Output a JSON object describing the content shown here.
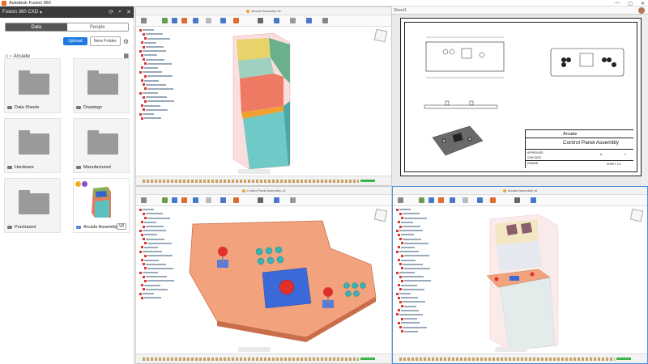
{
  "titlebar": {
    "title": "Autodesk Fusion 360",
    "min": "—",
    "max": "▢",
    "close": "✕"
  },
  "data_panel": {
    "team": "Fusion 360 CXD",
    "tabs": [
      {
        "label": "Data"
      },
      {
        "label": "People"
      }
    ],
    "upload_label": "Upload",
    "new_folder_label": "New Folder",
    "breadcrumb": "Arcade",
    "items": [
      {
        "name": "Data Sheets",
        "kind": "folder"
      },
      {
        "name": "Drawings",
        "kind": "folder"
      },
      {
        "name": "Hardware",
        "kind": "folder"
      },
      {
        "name": "Manufactured",
        "kind": "folder"
      },
      {
        "name": "Purchased",
        "kind": "folder"
      },
      {
        "name": "Arcade Assembly",
        "kind": "design",
        "version": "V8"
      }
    ]
  },
  "drawing": {
    "sheet_label": "Sheet1",
    "company": "Arcade",
    "title": "Control Panel Assembly",
    "approved_label": "APPROVED",
    "checked_label": "CHECKED",
    "drawn_label": "DRAWN",
    "size": "A",
    "rev": "1",
    "sheet": "SHEET 1/1"
  },
  "viewport_titles": [
    "Arcade Assembly v8",
    "Control Panel Assembly v3",
    "Arcade Assembly v8"
  ],
  "colors": {
    "accent": "#1f7ae0",
    "panel_dark": "#3b3b3b",
    "model_orange": "#f4a07a",
    "model_blue": "#5a7bd6",
    "model_teal": "#37b3b5",
    "model_red": "#e0463c",
    "timeline_green": "#39b54a"
  }
}
